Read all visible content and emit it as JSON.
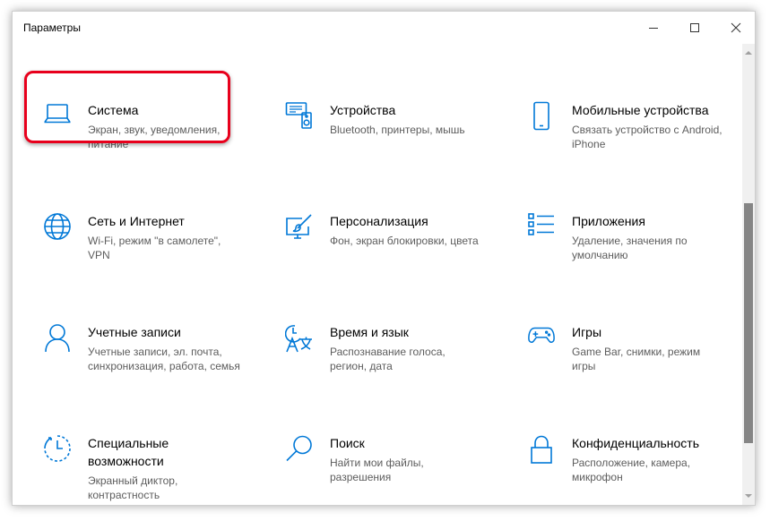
{
  "window": {
    "title": "Параметры"
  },
  "colors": {
    "accent": "#0078d7",
    "highlight": "#e8001c",
    "description_text": "#5d5d5d"
  },
  "tiles": [
    {
      "label": "Система",
      "desc": "Экран, звук, уведомления,",
      "desc2": "питание",
      "icon": "laptop-icon"
    },
    {
      "label": "Устройства",
      "desc": "Bluetooth, принтеры, мышь",
      "desc2": "",
      "icon": "devices-icon"
    },
    {
      "label": "Мобильные устройства",
      "desc": "Связать устройство с Android,",
      "desc2": "iPhone",
      "icon": "phone-icon"
    },
    {
      "label": "Сеть и Интернет",
      "desc": "Wi-Fi, режим \"в самолете\",",
      "desc2": "VPN",
      "icon": "globe-icon"
    },
    {
      "label": "Персонализация",
      "desc": "Фон, экран блокировки, цвета",
      "desc2": "",
      "icon": "paint-icon"
    },
    {
      "label": "Приложения",
      "desc": "Удаление, значения по",
      "desc2": "умолчанию",
      "icon": "apps-list-icon"
    },
    {
      "label": "Учетные записи",
      "desc": "Учетные записи, эл. почта,",
      "desc2": "синхронизация, работа, семья",
      "icon": "person-icon"
    },
    {
      "label": "Время и язык",
      "desc": "Распознавание голоса,",
      "desc2": "регион, дата",
      "icon": "time-language-icon"
    },
    {
      "label": "Игры",
      "desc": "Game Bar, снимки, режим",
      "desc2": "игры",
      "icon": "gamepad-icon"
    },
    {
      "label": "Специальные",
      "label2": "возможности",
      "desc": "Экранный диктор,",
      "desc2": "контрастность",
      "icon": "accessibility-icon"
    },
    {
      "label": "Поиск",
      "desc": "Найти мои файлы,",
      "desc2": "разрешения",
      "icon": "search-icon"
    },
    {
      "label": "Конфиденциальность",
      "desc": "Расположение, камера,",
      "desc2": "микрофон",
      "icon": "lock-icon"
    }
  ]
}
